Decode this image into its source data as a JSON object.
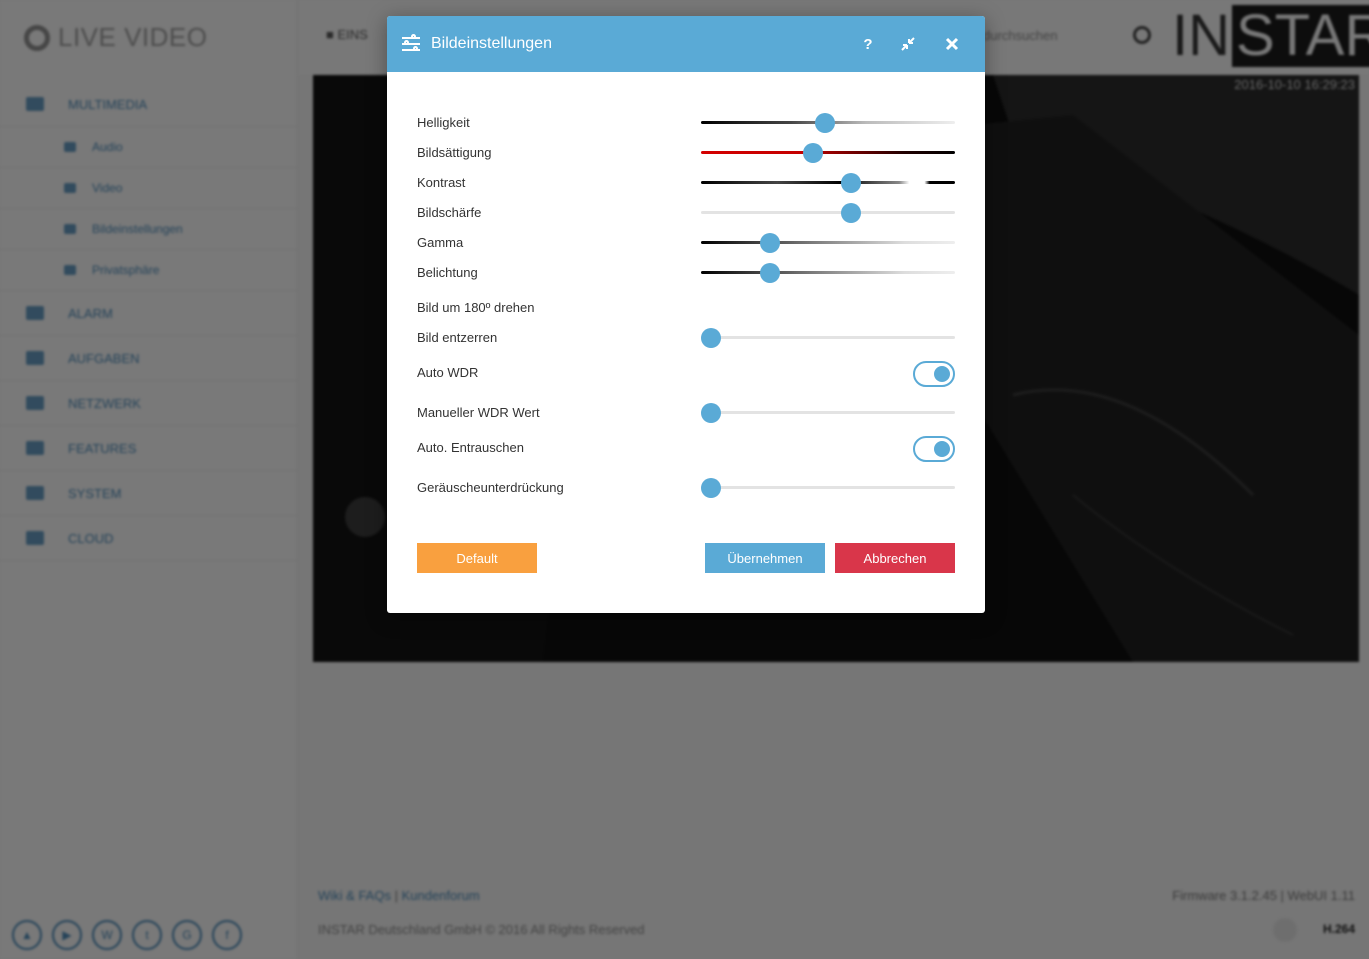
{
  "background": {
    "sidebar": {
      "title": "LIVE VIDEO",
      "items": [
        {
          "label": "MULTIMEDIA",
          "level": "main"
        },
        {
          "label": "Audio",
          "level": "sub"
        },
        {
          "label": "Video",
          "level": "sub"
        },
        {
          "label": "Bildeinstellungen",
          "level": "sub"
        },
        {
          "label": "Privatsphäre",
          "level": "sub"
        },
        {
          "label": "ALARM",
          "level": "main"
        },
        {
          "label": "AUFGABEN",
          "level": "main"
        },
        {
          "label": "NETZWERK",
          "level": "main"
        },
        {
          "label": "FEATURES",
          "level": "main"
        },
        {
          "label": "SYSTEM",
          "level": "main"
        },
        {
          "label": "CLOUD",
          "level": "main"
        }
      ]
    },
    "topbar": {
      "tab_label": "EINS",
      "search_text": "durchsuchen",
      "brand_left": "IN",
      "brand_right": "STAR"
    },
    "video": {
      "timestamp": "2016-10-10 16:29:23"
    },
    "footer": {
      "link_wiki": "Wiki & FAQs",
      "separator": "|",
      "link_forum": "Kundenforum",
      "copyright": "INSTAR Deutschland GmbH © 2016 All Rights Reserved",
      "firmware": "Firmware 3.1.2.45 | WebUI 1.11",
      "codec": "H.264"
    }
  },
  "modal": {
    "title": "Bildeinstellungen",
    "help_label": "?",
    "colors": {
      "accent": "#5aaad6",
      "default_btn": "#f9a03f",
      "apply_btn": "#5aaad6",
      "cancel_btn": "#d9364a"
    },
    "settings": [
      {
        "label": "Helligkeit",
        "type": "slider",
        "value": 0.49,
        "track": "brightness"
      },
      {
        "label": "Bildsättigung",
        "type": "slider",
        "value": 0.44,
        "track": "saturation"
      },
      {
        "label": "Kontrast",
        "type": "slider",
        "value": 0.59,
        "track": "contrast"
      },
      {
        "label": "Bildschärfe",
        "type": "slider",
        "value": 0.59,
        "track": "plain"
      },
      {
        "label": "Gamma",
        "type": "slider",
        "value": 0.27,
        "track": "dark-fade"
      },
      {
        "label": "Belichtung",
        "type": "slider",
        "value": 0.27,
        "track": "dark-fade"
      },
      {
        "label": "Bild um 180º drehen",
        "type": "none"
      },
      {
        "label": "Bild entzerren",
        "type": "slider",
        "value": 0.04,
        "track": "plain"
      },
      {
        "label": "Auto WDR",
        "type": "toggle",
        "on": true
      },
      {
        "label": "Manueller WDR Wert",
        "type": "slider",
        "value": 0.04,
        "track": "plain"
      },
      {
        "label": "Auto. Entrauschen",
        "type": "toggle",
        "on": true
      },
      {
        "label": "Geräuscheunterdrückung",
        "type": "slider",
        "value": 0.04,
        "track": "plain"
      }
    ],
    "buttons": {
      "default": "Default",
      "apply": "Übernehmen",
      "cancel": "Abbrechen"
    }
  }
}
